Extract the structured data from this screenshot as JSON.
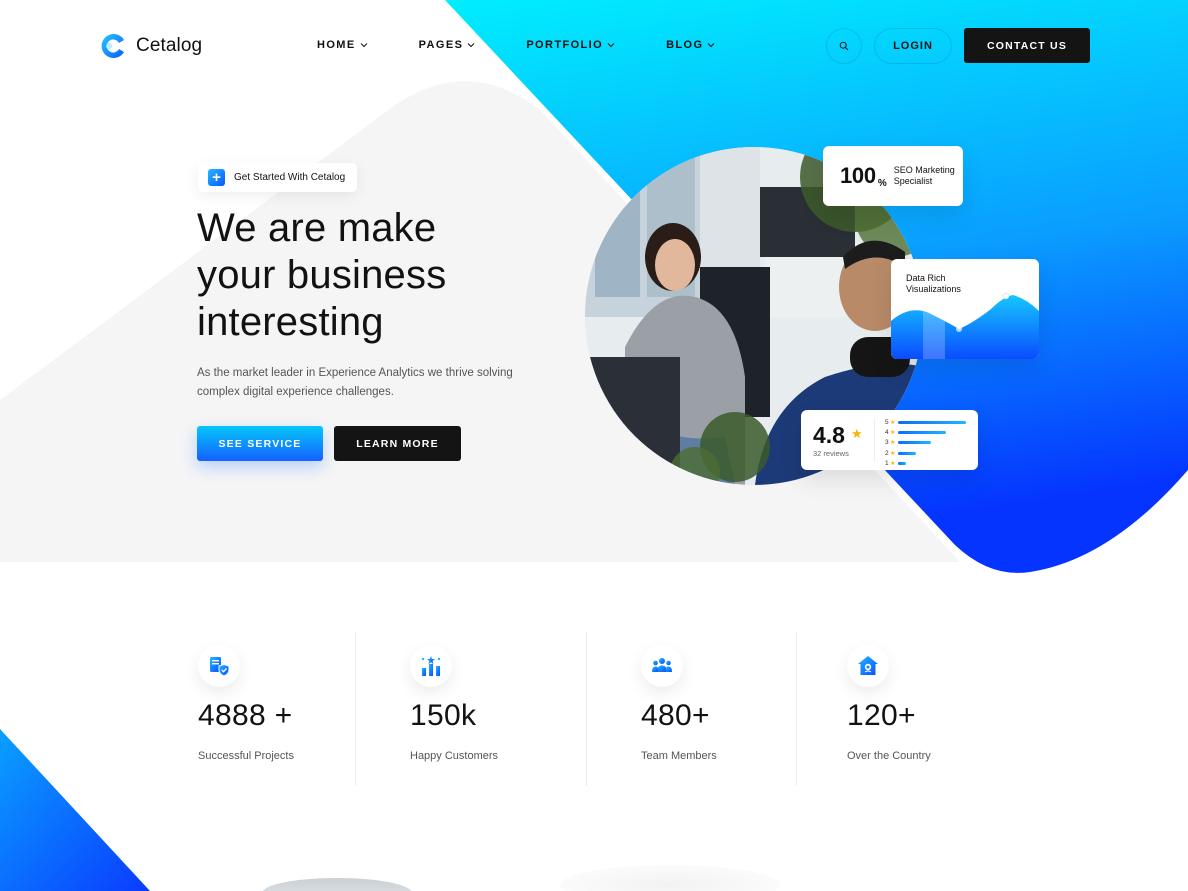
{
  "brand": {
    "name": "Cetalog"
  },
  "nav": {
    "items": [
      {
        "label": "HOME"
      },
      {
        "label": "PAGES"
      },
      {
        "label": "PORTFOLIO"
      },
      {
        "label": "BLOG"
      }
    ],
    "login_label": "LOGIN",
    "contact_label": "CONTACT US"
  },
  "hero": {
    "badge_text": "Get Started With Cetalog",
    "headline_line1": "We are make",
    "headline_line2": "your business",
    "headline_line3": "interesting",
    "subtext": "As the market leader in Experience Analytics we thrive solving complex digital experience challenges.",
    "primary_button": "SEE SERVICE",
    "secondary_button": "LEARN MORE"
  },
  "cards": {
    "seo": {
      "value": "100",
      "unit": "%",
      "label": "SEO Marketing Specialist"
    },
    "viz": {
      "label_line1": "Data Rich",
      "label_line2": "Visualizations"
    },
    "rating": {
      "value": "4.8",
      "count": "32 reviews",
      "bars": [
        {
          "stars": "5",
          "fraction": 1.0
        },
        {
          "stars": "4",
          "fraction": 0.7
        },
        {
          "stars": "3",
          "fraction": 0.48
        },
        {
          "stars": "2",
          "fraction": 0.27
        },
        {
          "stars": "1",
          "fraction": 0.12
        }
      ]
    }
  },
  "stats": [
    {
      "value": "4888 +",
      "label": "Successful Projects",
      "icon": "project-shield-icon"
    },
    {
      "value": "150k",
      "label": "Happy Customers",
      "icon": "growth-chart-icon"
    },
    {
      "value": "480+",
      "label": "Team Members",
      "icon": "team-icon"
    },
    {
      "value": "120+",
      "label": "Over the Country",
      "icon": "home-location-icon"
    }
  ],
  "colors": {
    "accent_cyan": "#00e5ff",
    "accent_blue": "#0a3cff",
    "dark": "#141414",
    "star": "#f7b500"
  }
}
